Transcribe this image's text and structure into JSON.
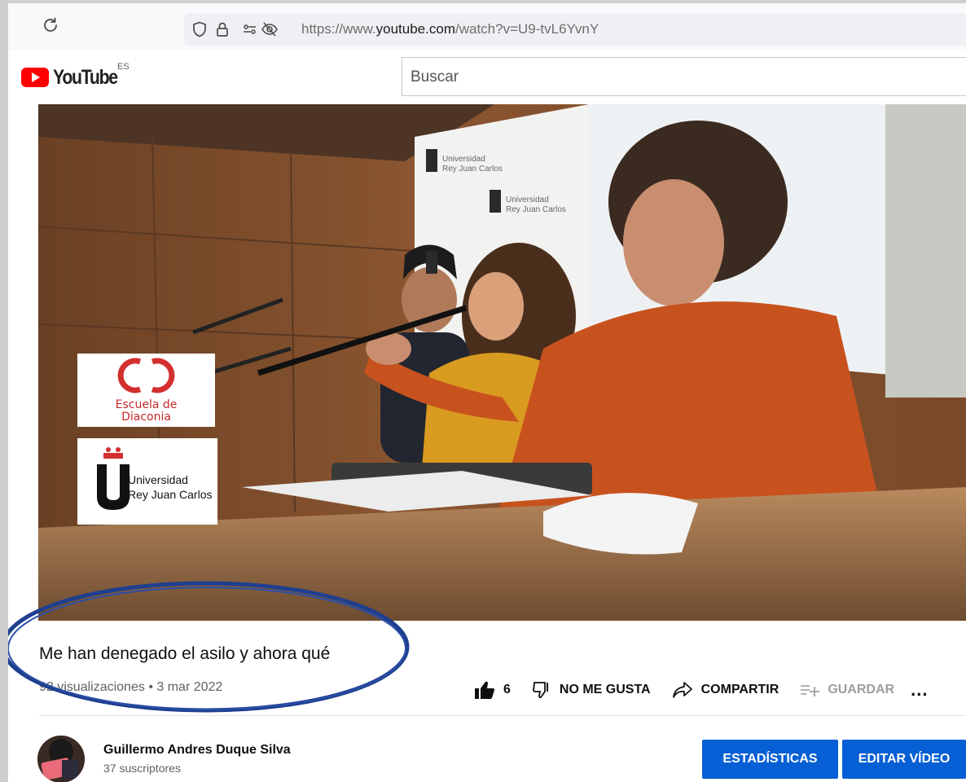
{
  "browser": {
    "url_prefix": "https://www.",
    "url_host": "youtube.com",
    "url_path": "/watch?v=U9-tvL6YvnY"
  },
  "header": {
    "logo_text": "YouTube",
    "country_code": "ES",
    "search_placeholder": "Buscar"
  },
  "video_overlay": {
    "school_logo_text_line1": "Escuela de",
    "school_logo_text_line2": "Diaconia",
    "university_logo_line1": "Universidad",
    "university_logo_line2": "Rey Juan Carlos",
    "banner_text_1a": "Universidad",
    "banner_text_1b": "Rey Juan Carlos",
    "banner_text_2a": "Universidad",
    "banner_text_2b": "Rey Juan Carlos"
  },
  "video": {
    "title": "Me han denegado el asilo y ahora qué",
    "views": "92 visualizaciones",
    "separator": "•",
    "date": "3 mar 2022"
  },
  "actions": {
    "like_count": "6",
    "dislike_label": "NO ME GUSTA",
    "share_label": "COMPARTIR",
    "save_label": "GUARDAR",
    "more_label": "..."
  },
  "channel": {
    "name": "Guillermo Andres Duque Silva",
    "subscribers": "37 suscriptores"
  },
  "buttons": {
    "stats_label": "ESTADÍSTICAS",
    "edit_label": "EDITAR VÍDEO"
  },
  "colors": {
    "youtube_red": "#ff0000",
    "primary_button": "#065fd4",
    "highlight_circle": "#1f3f8f"
  }
}
